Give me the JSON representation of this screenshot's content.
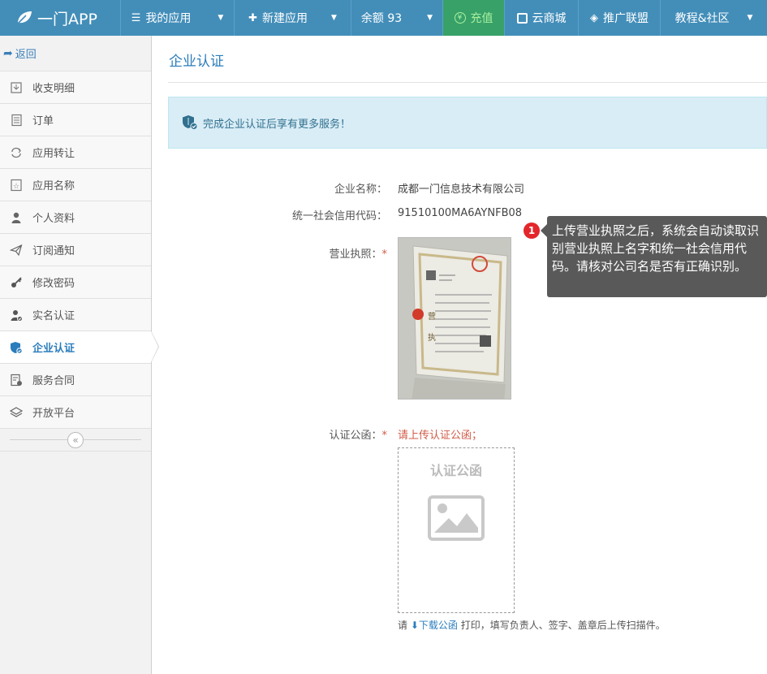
{
  "brand": {
    "name": "一门APP"
  },
  "nav": [
    {
      "label": "我的应用",
      "icon": "list-icon",
      "dropdown": true
    },
    {
      "label": "新建应用",
      "icon": "plus-icon",
      "dropdown": true
    },
    {
      "label": "余额 93",
      "icon": "",
      "dropdown": true
    },
    {
      "label": "充值",
      "icon": "yen-icon",
      "dropdown": false
    },
    {
      "label": "云商城",
      "icon": "store-icon",
      "dropdown": false
    },
    {
      "label": "推广联盟",
      "icon": "diamond-icon",
      "dropdown": false
    },
    {
      "label": "教程&社区",
      "icon": "",
      "dropdown": true
    }
  ],
  "sidebar": {
    "back_label": "返回",
    "items": [
      {
        "label": "收支明细",
        "icon": "ledger-icon"
      },
      {
        "label": "订单",
        "icon": "document-icon"
      },
      {
        "label": "应用转让",
        "icon": "transfer-icon"
      },
      {
        "label": "应用名称",
        "icon": "star-icon"
      },
      {
        "label": "个人资料",
        "icon": "user-icon"
      },
      {
        "label": "订阅通知",
        "icon": "paper-plane-icon"
      },
      {
        "label": "修改密码",
        "icon": "key-icon"
      },
      {
        "label": "实名认证",
        "icon": "user-check-icon"
      },
      {
        "label": "企业认证",
        "icon": "shield-check-icon",
        "active": true
      },
      {
        "label": "服务合同",
        "icon": "contract-icon"
      },
      {
        "label": "开放平台",
        "icon": "layers-icon"
      }
    ]
  },
  "main": {
    "title": "企业认证",
    "alert": "完成企业认证后享有更多服务！",
    "fields": {
      "company_label": "企业名称：",
      "company_value": "成都一门信息技术有限公司",
      "credit_label": "统一社会信用代码：",
      "credit_value": "91510100MA6AYNFB08",
      "license_label": "营业执照：",
      "letter_label": "认证公函：",
      "required_mark": "*",
      "letter_hint": "请上传认证公函；",
      "upload_title": "认证公函",
      "note_prefix": "请",
      "note_link": "下载公函",
      "note_suffix": "打印，填写负责人、签字、盖章后上传扫描件。"
    },
    "tooltip": {
      "badge": "1",
      "text": "上传营业执照之后，系统会自动读取识别营业执照上名字和统一社会信用代码。请核对公司名是否有正确识别。"
    }
  },
  "colors": {
    "topbar": "#438eb9",
    "accent": "#2b7dbc",
    "recharge": "#38a168",
    "required": "#d15b47"
  }
}
